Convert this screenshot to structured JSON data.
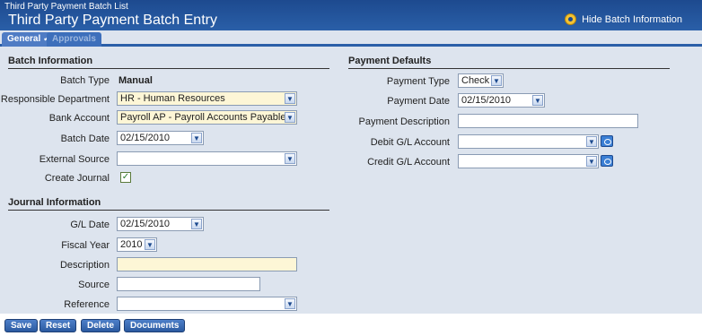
{
  "header": {
    "breadcrumb": "Third Party Payment Batch List",
    "title": "Third Party Payment Batch Entry",
    "hide_label": "Hide Batch Information"
  },
  "tabs": [
    {
      "label": "General ✓"
    },
    {
      "label": "Approvals"
    }
  ],
  "batch": {
    "heading": "Batch Information",
    "type_label": "Batch Type",
    "type_value": "Manual",
    "dept_label": "Responsible Department",
    "dept_value": "HR - Human Resources",
    "bank_label": "Bank Account",
    "bank_value": "Payroll AP - Payroll Accounts Payable",
    "date_label": "Batch Date",
    "date_value": "02/15/2010",
    "ext_label": "External Source",
    "ext_value": "",
    "journal_label": "Create Journal",
    "journal_checked": true
  },
  "journal": {
    "heading": "Journal Information",
    "gl_date_label": "G/L Date",
    "gl_date_value": "02/15/2010",
    "fiscal_label": "Fiscal Year",
    "fiscal_value": "2010",
    "desc_label": "Description",
    "desc_value": "",
    "source_label": "Source",
    "source_value": "",
    "ref_label": "Reference",
    "ref_value": ""
  },
  "payment": {
    "heading": "Payment Defaults",
    "type_label": "Payment Type",
    "type_value": "Check",
    "date_label": "Payment Date",
    "date_value": "02/15/2010",
    "desc_label": "Payment Description",
    "desc_value": "",
    "debit_label": "Debit G/L Account",
    "debit_value": "",
    "credit_label": "Credit G/L Account",
    "credit_value": ""
  },
  "buttons": {
    "save": "Save",
    "reset": "Reset",
    "delete": "Delete",
    "documents": "Documents"
  }
}
